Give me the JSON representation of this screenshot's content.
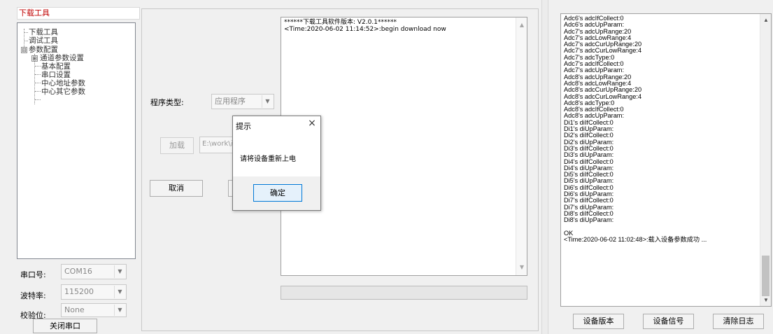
{
  "left_panel": {
    "title": "下载工具",
    "tree": {
      "download": "下载工具",
      "debug": "调试工具",
      "params": "参数配置",
      "expand_glyph": "⊞",
      "collapse_glyph": "⊟",
      "channel": "通道参数设置",
      "basic": "基本配置",
      "serial": "串口设置",
      "center_addr": "中心地址参数",
      "center_other": "中心其它参数"
    },
    "port_label": "串口号:",
    "port_value": "COM16",
    "baud_label": "波特率:",
    "baud_value": "115200",
    "parity_label": "校验位:",
    "parity_value": "None",
    "close_port": "关闭串口"
  },
  "middle": {
    "program_type_label": "程序类型:",
    "program_type_value": "应用程序",
    "load_button": "加载",
    "path_value": "E:\\work\\产",
    "cancel_button": "取消",
    "log_lines": [
      "******下载工具软件版本: V2.0.1******",
      "<Time:2020-06-02 11:14:52>:begin download  now"
    ]
  },
  "dialog": {
    "title": "提示",
    "close": "×",
    "message": "请将设备重新上电",
    "ok": "确定"
  },
  "right_log": {
    "lines": [
      "Adc6's adcIfCollect:0",
      "Adc6's adcUpParam:",
      "Adc7's adcUpRange:20",
      "Adc7's adcLowRange:4",
      "Adc7's adcCurUpRange:20",
      "Adc7's adcCurLowRange:4",
      "Adc7's adcType:0",
      "Adc7's adcIfCollect:0",
      "Adc7's adcUpParam:",
      "Adc8's adcUpRange:20",
      "Adc8's adcLowRange:4",
      "Adc8's adcCurUpRange:20",
      "Adc8's adcCurLowRange:4",
      "Adc8's adcType:0",
      "Adc8's adcIfCollect:0",
      "Adc8's adcUpParam:",
      "Di1's diIfCollect:0",
      "Di1's diUpParam:",
      "Di2's diIfCollect:0",
      "Di2's diUpParam:",
      "Di3's diIfCollect:0",
      "Di3's diUpParam:",
      "Di4's diIfCollect:0",
      "Di4's diUpParam:",
      "Di5's diIfCollect:0",
      "Di5's diUpParam:",
      "Di6's diIfCollect:0",
      "Di6's diUpParam:",
      "Di7's diIfCollect:0",
      "Di7's diUpParam:",
      "Di8's diIfCollect:0",
      "Di8's diUpParam:",
      "",
      "OK",
      "<Time:2020-06-02 11:02:48>:载入设备参数成功 ..."
    ],
    "buttons": {
      "version": "设备版本",
      "signal": "设备信号",
      "clear": "清除日志"
    }
  },
  "colors": {
    "title_red": "#c00000",
    "dialog_accent": "#0078d7"
  }
}
